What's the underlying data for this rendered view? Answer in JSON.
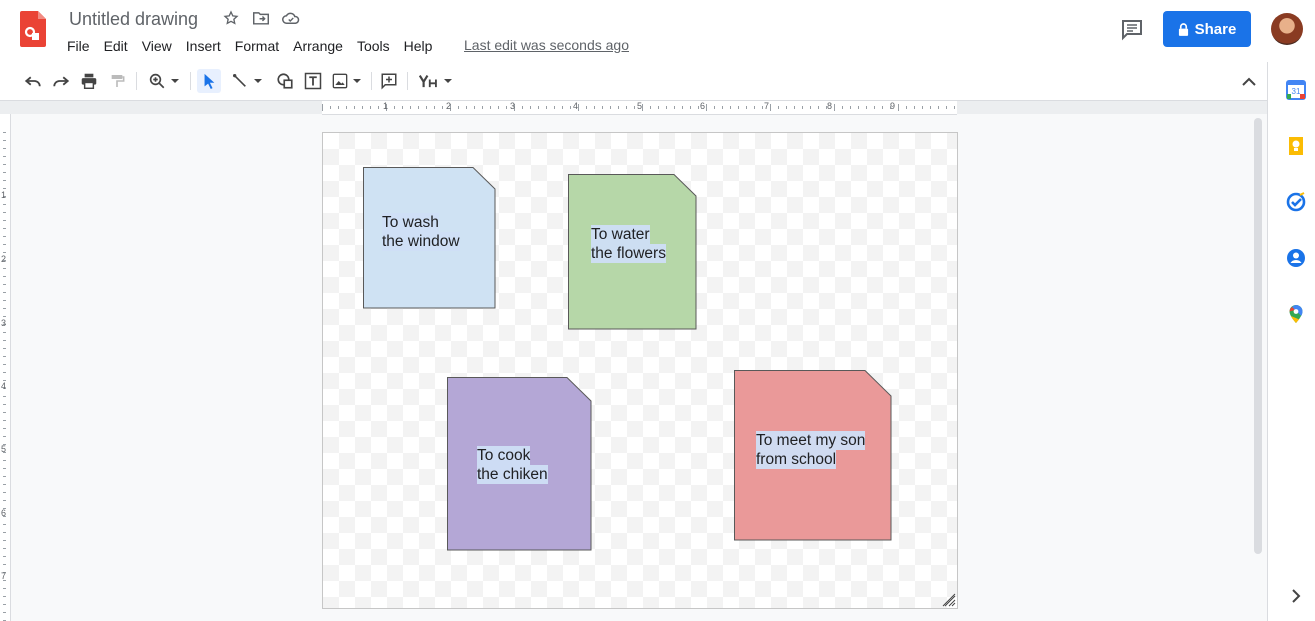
{
  "header": {
    "title": "Untitled drawing",
    "last_edit": "Last edit was seconds ago",
    "share_label": "Share"
  },
  "menu": [
    "File",
    "Edit",
    "View",
    "Insert",
    "Format",
    "Arrange",
    "Tools",
    "Help"
  ],
  "ruler": {
    "horizontal": [
      "1",
      "2",
      "3",
      "4",
      "5",
      "6",
      "7",
      "8",
      "9"
    ],
    "vertical": [
      "1",
      "2",
      "3",
      "4",
      "5",
      "6",
      "7"
    ]
  },
  "notes": [
    {
      "line1": "To wash",
      "line2": "the window",
      "color": "#cfe2f3"
    },
    {
      "line1": "To water",
      "line2": "the flowers",
      "color": "#b6d7a8"
    },
    {
      "line1": "To cook",
      "line2": "the chiken",
      "color": "#b4a7d6"
    },
    {
      "line1": "To meet my son",
      "line2": "from school",
      "color": "#ea9999"
    }
  ],
  "colors": {
    "accent": "#1a73e8",
    "app_red": "#ea4335"
  }
}
